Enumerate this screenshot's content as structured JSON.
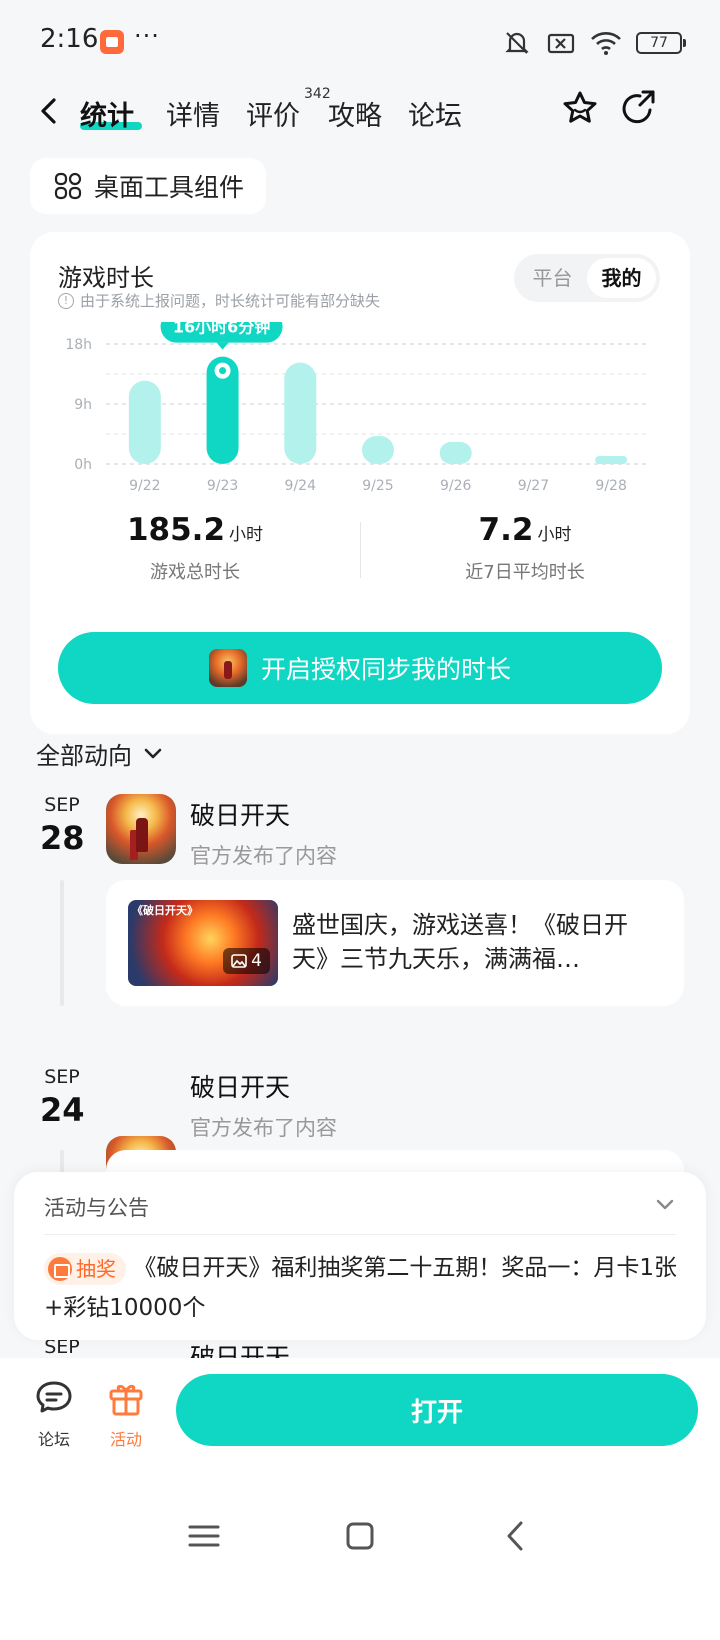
{
  "status_bar": {
    "time": "2:16",
    "dots": "···",
    "battery": "77"
  },
  "tabs": [
    {
      "label": "统计"
    },
    {
      "label": "详情"
    },
    {
      "label": "评价",
      "badge": "342"
    },
    {
      "label": "攻略"
    },
    {
      "label": "论坛"
    }
  ],
  "widget_button": {
    "label": "桌面工具组件"
  },
  "stats": {
    "title": "游戏时长",
    "note": "由于系统上报问题，时长统计可能有部分缺失",
    "toggle": [
      "平台",
      "我的"
    ],
    "total_value": "185.2",
    "total_unit": "小时",
    "total_label": "游戏总时长",
    "avg_value": "7.2",
    "avg_unit": "小时",
    "avg_label": "近7日平均时长",
    "sync_button": "开启授权同步我的时长"
  },
  "chart_data": {
    "type": "bar",
    "categories": [
      "9/22",
      "9/23",
      "9/24",
      "9/25",
      "9/26",
      "9/27",
      "9/28"
    ],
    "values": [
      12.5,
      16.1,
      15.2,
      4.2,
      3.3,
      0,
      1.2
    ],
    "y_ticks": [
      "18h",
      "9h",
      "0h"
    ],
    "ylim": [
      0,
      18
    ],
    "highlight_index": 1,
    "tooltip": "16小时6分钟",
    "colors": {
      "bar": "#b3f1ec",
      "highlight": "#10d6c4"
    }
  },
  "feed": {
    "header": "全部动向",
    "entries": [
      {
        "month": "SEP",
        "day": "28",
        "name": "破日开天",
        "sub": "官方发布了内容",
        "post": {
          "text": "盛世国庆，游戏送喜！《破日开天》三节九天乐，满满福…",
          "image_title": "《破日开天》",
          "image_count": "4"
        }
      },
      {
        "month": "SEP",
        "day": "24",
        "name": "破日开天",
        "sub": "官方发布了内容"
      },
      {
        "month": "SEP",
        "name": "破日开天"
      }
    ]
  },
  "announcement": {
    "title": "活动与公告",
    "tag": "抽奖",
    "text": "《破日开天》福利抽奖第二十五期！奖品一：月卡1张+彩钻10000个"
  },
  "bottom_bar": {
    "forum_label": "论坛",
    "activity_label": "活动",
    "open_label": "打开"
  },
  "colors": {
    "accent": "#10d6c4",
    "orange": "#ff7a3d"
  }
}
